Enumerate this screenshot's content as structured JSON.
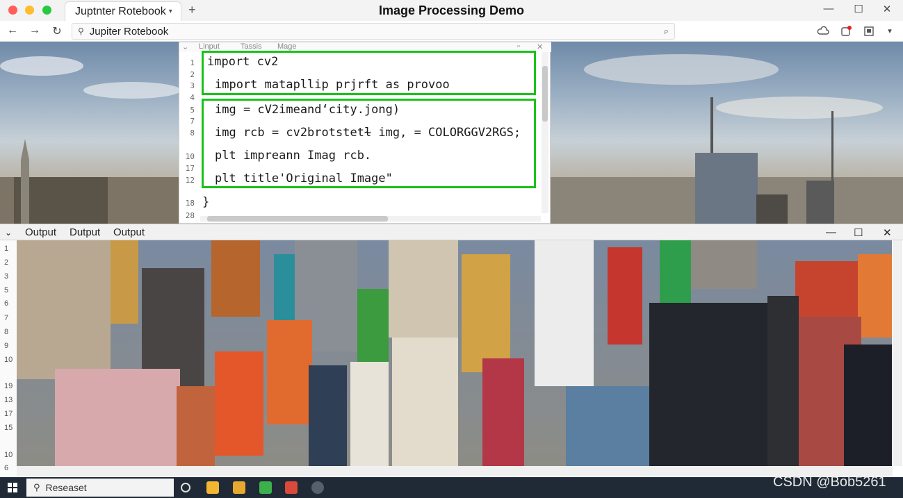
{
  "window": {
    "title": "Image Processing Demo",
    "tab_label": "Juptnter Rotebook",
    "new_tab": "+",
    "controls": {
      "minimize": "—",
      "maximize": "☐",
      "close": "✕"
    }
  },
  "address_bar": {
    "url": "Jupiter Rotebook",
    "back": "←",
    "forward": "→",
    "reload": "↻"
  },
  "editor": {
    "header_tabs": [
      "Linput",
      "Tassis",
      "Mage"
    ],
    "close": "✕",
    "line_numbers": [
      "1",
      "2",
      "3",
      "4",
      "5",
      "7",
      "8",
      "10",
      "17",
      "12",
      "18",
      "28"
    ],
    "lines": [
      "import cv2",
      "import matapllip prjrft as provoo",
      "img = cV2imeand‘city.jong)",
      "img rcb = cv2brotstetɫ img, = COLORGGV2RGS;",
      "plt impreann Imag rcb.",
      "plt title'Original Image\"",
      "}"
    ]
  },
  "output": {
    "tabs": [
      "Output",
      "Dutput",
      "Output"
    ],
    "panel_toggle": "⌄",
    "controls": {
      "minimize": "—",
      "maximize": "☐",
      "close": "✕"
    },
    "line_numbers": [
      "1",
      "2",
      "3",
      "5",
      "6",
      "7",
      "8",
      "9",
      "10",
      "19",
      "13",
      "17",
      "15",
      "10",
      "6"
    ]
  },
  "taskbar": {
    "search_label": "Reseaset",
    "watermark": "CSDN @Bob5261"
  },
  "colors": {
    "highlight": "#19c219",
    "taskbar": "#1f2a36"
  }
}
